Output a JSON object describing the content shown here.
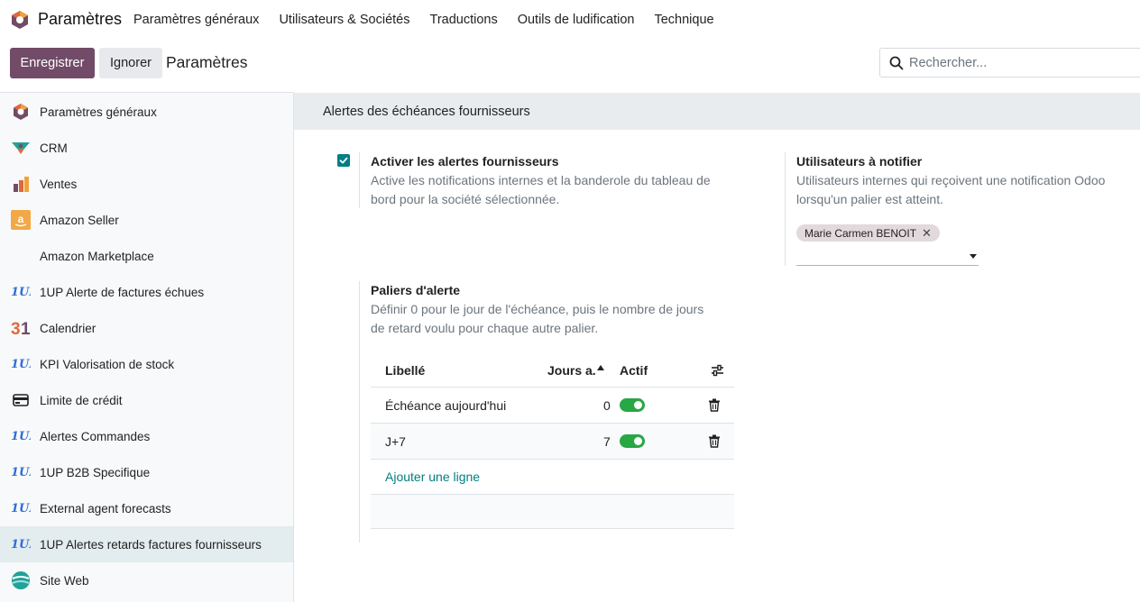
{
  "app": {
    "name": "Paramètres"
  },
  "topmenu": [
    "Paramètres généraux",
    "Utilisateurs & Sociétés",
    "Traductions",
    "Outils de ludification",
    "Technique"
  ],
  "control_panel": {
    "save_label": "Enregistrer",
    "discard_label": "Ignorer",
    "breadcrumb": "Paramètres",
    "search_placeholder": "Rechercher..."
  },
  "sidebar": {
    "items": [
      {
        "label": "Paramètres généraux",
        "icon": "settings-app-icon"
      },
      {
        "label": "CRM",
        "icon": "crm-icon"
      },
      {
        "label": "Ventes",
        "icon": "sales-icon"
      },
      {
        "label": "Amazon Seller",
        "icon": "amazon-icon"
      },
      {
        "label": "Amazon Marketplace",
        "icon": ""
      },
      {
        "label": "1UP Alerte de factures échues",
        "icon": "1up-icon"
      },
      {
        "label": "Calendrier",
        "icon": "calendar-icon"
      },
      {
        "label": "KPI Valorisation de stock",
        "icon": "1up-icon"
      },
      {
        "label": "Limite de crédit",
        "icon": "credit-card-icon"
      },
      {
        "label": "Alertes Commandes",
        "icon": "1up-icon"
      },
      {
        "label": "1UP B2B Specifique",
        "icon": "1up-icon"
      },
      {
        "label": "External agent forecasts",
        "icon": "1up-icon"
      },
      {
        "label": "1UP Alertes retards factures fournisseurs",
        "icon": "1up-icon",
        "active": true
      },
      {
        "label": "Site Web",
        "icon": "website-icon"
      }
    ]
  },
  "section": {
    "title": "Alertes des échéances fournisseurs"
  },
  "activate": {
    "checked": true,
    "title": "Activer les alertes fournisseurs",
    "desc_line1": "Active les notifications internes et la banderole du tableau de",
    "desc_line2": "bord pour la société sélectionnée."
  },
  "notify": {
    "title": "Utilisateurs à notifier",
    "desc_line1": "Utilisateurs internes qui reçoivent une notification Odoo",
    "desc_line2": "lorsqu'un palier est atteint.",
    "tags": [
      "Marie Carmen BENOIT"
    ]
  },
  "tiers": {
    "title": "Paliers d'alerte",
    "desc_line1": "Définir 0 pour le jour de l'échéance, puis le nombre de jours",
    "desc_line2": "de retard voulu pour chaque autre palier.",
    "columns": {
      "label": "Libellé",
      "days": "Jours a.",
      "active": "Actif"
    },
    "rows": [
      {
        "label": "Échéance aujourd'hui",
        "days": "0",
        "active": true
      },
      {
        "label": "J+7",
        "days": "7",
        "active": true
      }
    ],
    "add_line": "Ajouter une ligne"
  },
  "colors": {
    "primary": "#714b67",
    "accent": "#017e84",
    "toggle_on": "#28a745"
  }
}
